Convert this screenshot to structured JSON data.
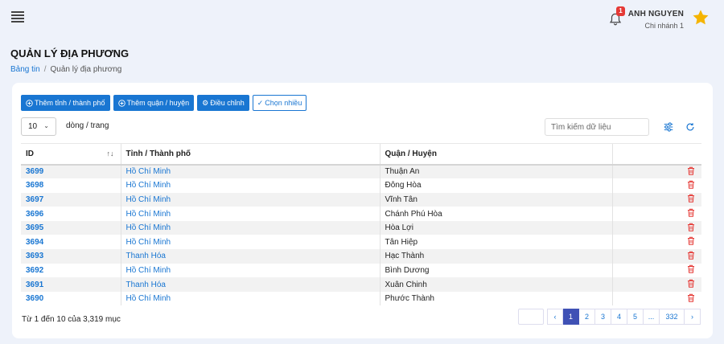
{
  "header": {
    "notification_count": "1",
    "user_name": "ANH NGUYEN",
    "user_branch": "Chi nhánh 1"
  },
  "page": {
    "title": "QUẢN LÝ ĐỊA PHƯƠNG",
    "breadcrumb": [
      "Bảng tin",
      "Quản lý địa phương"
    ]
  },
  "toolbar": {
    "add_province": "Thêm tỉnh / thành phố",
    "add_district": "Thêm quận / huyện",
    "adjust": "Điều chỉnh",
    "multi_select": "Chọn nhiều"
  },
  "controls": {
    "page_size": "10",
    "rows_per_page_label": "dòng / trang",
    "search_placeholder": "Tìm kiếm dữ liệu"
  },
  "table": {
    "columns": [
      "ID",
      "Tỉnh / Thành phố",
      "Quận / Huyện",
      ""
    ],
    "rows": [
      {
        "id": "3699",
        "province": "Hồ Chí Minh",
        "district": "Thuận An"
      },
      {
        "id": "3698",
        "province": "Hồ Chí Minh",
        "district": "Đông Hòa"
      },
      {
        "id": "3697",
        "province": "Hồ Chí Minh",
        "district": "Vĩnh Tân"
      },
      {
        "id": "3696",
        "province": "Hồ Chí Minh",
        "district": "Chánh Phú Hòa"
      },
      {
        "id": "3695",
        "province": "Hồ Chí Minh",
        "district": "Hòa Lợi"
      },
      {
        "id": "3694",
        "province": "Hồ Chí Minh",
        "district": "Tân Hiệp"
      },
      {
        "id": "3693",
        "province": "Thanh Hóa",
        "district": "Hạc Thành"
      },
      {
        "id": "3692",
        "province": "Hồ Chí Minh",
        "district": "Bình Dương"
      },
      {
        "id": "3691",
        "province": "Thanh Hóa",
        "district": "Xuân Chinh"
      },
      {
        "id": "3690",
        "province": "Hồ Chí Minh",
        "district": "Phước Thành"
      }
    ]
  },
  "footer": {
    "summary": "Từ 1 đến 10 của 3,319 mục",
    "pagination": {
      "prev": "‹",
      "pages": [
        "1",
        "2",
        "3",
        "4",
        "5",
        "...",
        "332"
      ],
      "active": "1",
      "next": "›"
    }
  },
  "colors": {
    "accent": "#1976d2",
    "active_page": "#3f51b5",
    "badge": "#e53935",
    "delete": "#e53935",
    "star": "#f5b400"
  },
  "icons": {
    "menu": "hamburger-icon",
    "notification": "bell-icon",
    "favorite": "star-icon",
    "add": "plus-circle-icon",
    "adjust": "gear-icon",
    "multi_select": "check-double-icon",
    "page_size_caret": "chevron-down-icon",
    "filter": "sliders-icon",
    "refresh": "refresh-icon",
    "sort": "sort-icon",
    "delete": "trash-icon"
  }
}
